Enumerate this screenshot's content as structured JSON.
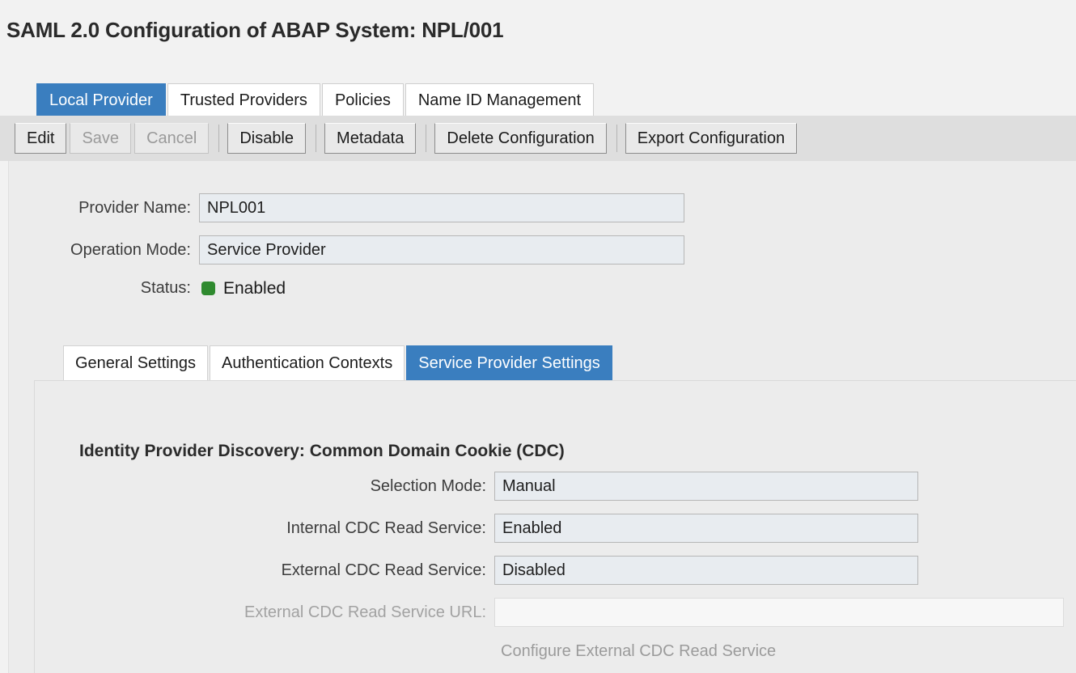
{
  "page": {
    "title": "SAML 2.0 Configuration of ABAP System: NPL/001"
  },
  "main_tabs": [
    {
      "label": "Local Provider",
      "active": true
    },
    {
      "label": "Trusted Providers",
      "active": false
    },
    {
      "label": "Policies",
      "active": false
    },
    {
      "label": "Name ID Management",
      "active": false
    }
  ],
  "toolbar": {
    "buttons": [
      {
        "label": "Edit",
        "disabled": false
      },
      {
        "label": "Save",
        "disabled": true
      },
      {
        "label": "Cancel",
        "disabled": true
      },
      {
        "label": "Disable",
        "disabled": false
      },
      {
        "label": "Metadata",
        "disabled": false
      },
      {
        "label": "Delete Configuration",
        "disabled": false
      },
      {
        "label": "Export Configuration",
        "disabled": false
      }
    ]
  },
  "provider": {
    "name_label": "Provider Name:",
    "name_value": "NPL001",
    "mode_label": "Operation Mode:",
    "mode_value": "Service Provider",
    "status_label": "Status:",
    "status_value": "Enabled",
    "status_color": "#2f8a2f"
  },
  "inner_tabs": [
    {
      "label": "General Settings",
      "active": false
    },
    {
      "label": "Authentication Contexts",
      "active": false
    },
    {
      "label": "Service Provider Settings",
      "active": true
    }
  ],
  "cdc": {
    "heading": "Identity Provider Discovery: Common Domain Cookie (CDC)",
    "selection_mode_label": "Selection Mode:",
    "selection_mode_value": "Manual",
    "internal_label": "Internal CDC Read Service:",
    "internal_value": "Enabled",
    "external_label": "External CDC Read Service:",
    "external_value": "Disabled",
    "external_url_label": "External CDC Read Service URL:",
    "external_url_value": "",
    "configure_link": "Configure External CDC Read Service"
  },
  "theme": {
    "accent": "#3a7ebf",
    "page_bg": "#f2f2f2",
    "panel_bg": "#ececec",
    "toolbar_bg": "#dedede",
    "input_bg": "#e8ecf0"
  }
}
